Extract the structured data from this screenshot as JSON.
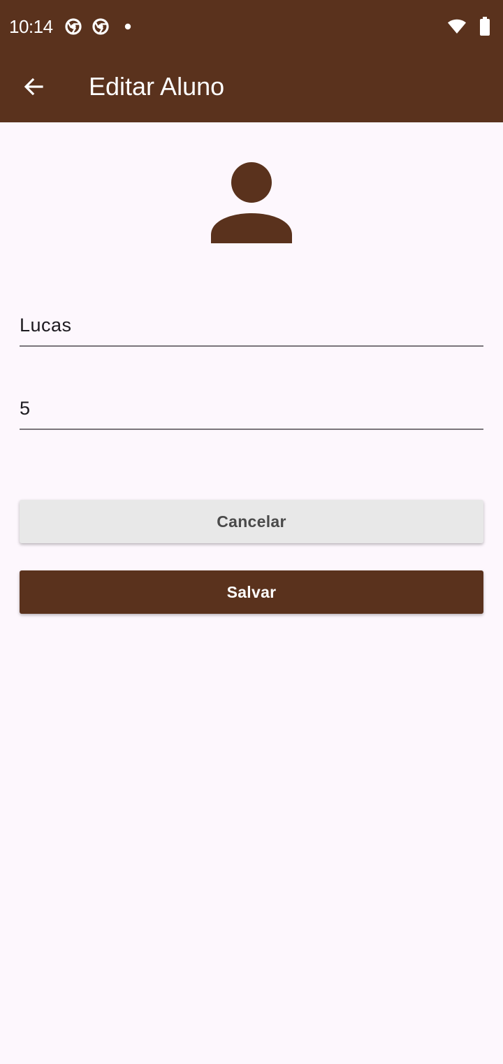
{
  "status_bar": {
    "time": "10:14",
    "left_icons": [
      "chrome-icon",
      "chrome-icon",
      "notification-dot-icon"
    ],
    "right_icons": [
      "wifi-icon",
      "battery-icon"
    ]
  },
  "app_bar": {
    "back_icon": "arrow-back-icon",
    "title": "Editar Aluno"
  },
  "avatar": {
    "icon": "person-icon"
  },
  "form": {
    "name_value": "Lucas",
    "grade_value": "5"
  },
  "actions": {
    "cancel_label": "Cancelar",
    "save_label": "Salvar"
  },
  "colors": {
    "primary": "#5a321d",
    "background": "#fdf7fd",
    "cancel_bg": "#e8e8e8"
  }
}
